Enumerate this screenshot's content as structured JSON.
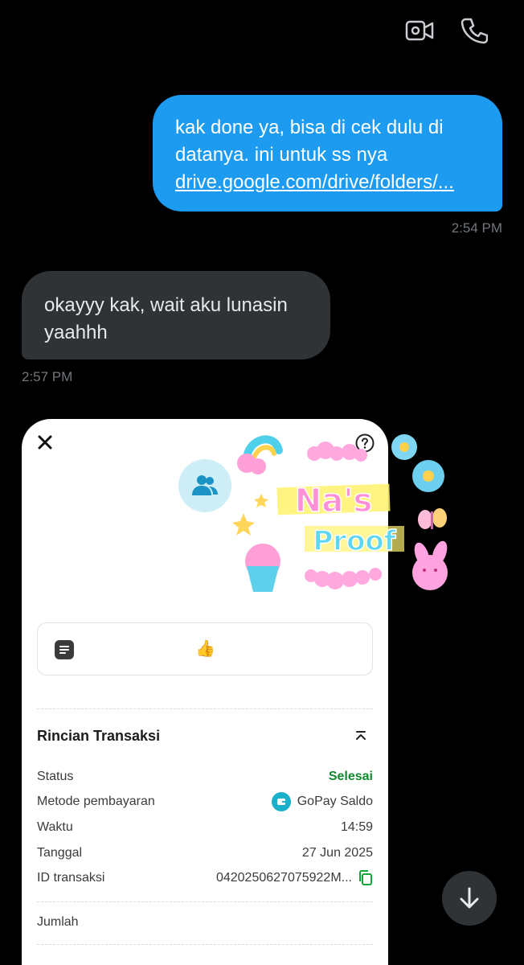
{
  "header": {
    "video_icon": "video-call-icon",
    "phone_icon": "phone-call-icon"
  },
  "messages": {
    "outgoing": {
      "line1": "kak done ya, bisa di cek dulu di",
      "line2": "datanya. ini untuk ss nya",
      "link": "drive.google.com/drive/folders/...",
      "time": "2:54 PM"
    },
    "incoming": {
      "line1": "okayyy kak, wait aku lunasin",
      "line2": "yaahhh",
      "time": "2:57 PM"
    }
  },
  "receipt": {
    "note_emoji": "👍",
    "section_title": "Rincian Transaksi",
    "rows": [
      {
        "label": "Status",
        "value": "Selesai"
      },
      {
        "label": "Metode pembayaran",
        "value": "GoPay Saldo"
      },
      {
        "label": "Waktu",
        "value": "14:59"
      },
      {
        "label": "Tanggal",
        "value": "27 Jun 2025"
      },
      {
        "label": "ID transaksi",
        "value": "0420250627075922M..."
      },
      {
        "label": "Jumlah",
        "value": ""
      }
    ],
    "colors": {
      "success": "#118a2f",
      "gopay": "#1bb0c9"
    }
  },
  "sticker": {
    "line1": "Na's",
    "line2": "Proof"
  },
  "colors": {
    "outgoing_bubble": "#1d9bf0",
    "incoming_bubble": "#2f3336",
    "background": "#000000"
  }
}
